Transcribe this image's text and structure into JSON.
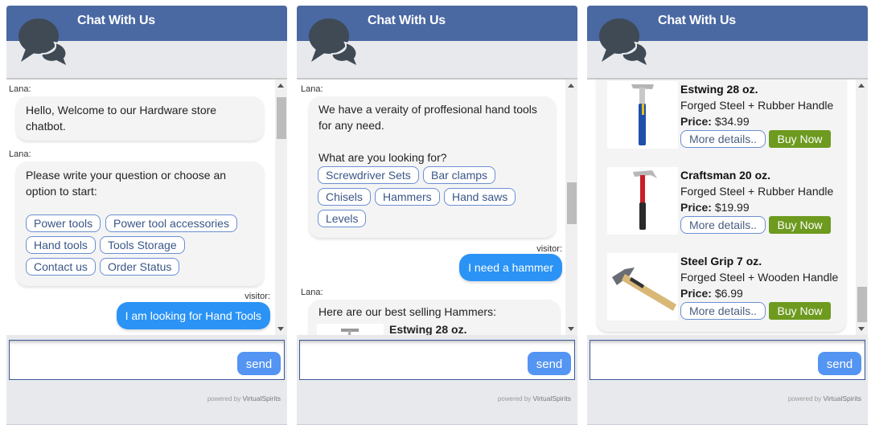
{
  "widgets": [
    {
      "header": {
        "title": "Chat With Us"
      },
      "messages": [
        {
          "sender": "Lana:",
          "text": [
            "Hello, Welcome to our Hardware store",
            "chatbot."
          ]
        },
        {
          "sender": "Lana:",
          "text": [
            "Please write your question or choose an",
            "option to start:"
          ],
          "options": [
            "Power tools",
            "Power tool accessories",
            "Hand tools",
            "Tools Storage",
            "Contact us",
            "Order Status"
          ]
        },
        {
          "sender": "visitor:",
          "text": "I am looking for Hand Tools"
        }
      ],
      "input": {
        "placeholder": "",
        "send_label": "send"
      },
      "powered": {
        "prefix": "powered  by ",
        "brand": "VirtualSpirits"
      }
    },
    {
      "header": {
        "title": "Chat With Us"
      },
      "messages": [
        {
          "sender": "Lana:",
          "text": [
            "We have a veraity of proffesional hand tools",
            "for any need.",
            "",
            "What are you looking for?"
          ],
          "options": [
            "Screwdriver Sets",
            "Bar clamps",
            "Chisels",
            "Hammers",
            "Hand saws",
            "Levels"
          ]
        },
        {
          "sender": "visitor:",
          "text": "I need a hammer"
        },
        {
          "sender": "Lana:",
          "text": "Here are our best selling Hammers:",
          "first_product": "Estwing 28 oz."
        }
      ],
      "input": {
        "placeholder": "",
        "send_label": "send"
      },
      "powered": {
        "prefix": "powered  by ",
        "brand": "VirtualSpirits"
      }
    },
    {
      "header": {
        "title": "Chat With Us"
      },
      "products": [
        {
          "name": "Estwing 28 oz.",
          "desc": "Forged Steel + Rubber Handle",
          "price_label": "Price:",
          "price": "$34.99",
          "more": "More details..",
          "buy": "Buy Now",
          "handle_color": "#1f4fa8"
        },
        {
          "name": "Craftsman 20 oz.",
          "desc": "Forged Steel + Rubber Handle",
          "price_label": "Price:",
          "price": "$19.99",
          "more": "More details..",
          "buy": "Buy Now",
          "handle_color": "#c81e28"
        },
        {
          "name": "Steel Grip 7 oz.",
          "desc": "Forged Steel + Wooden Handle",
          "price_label": "Price:",
          "price": "$6.99",
          "more": "More details..",
          "buy": "Buy Now",
          "handle_color": "#d9b877"
        }
      ],
      "input": {
        "placeholder": "",
        "send_label": "send"
      },
      "powered": {
        "prefix": "powered  by ",
        "brand": "VirtualSpirits"
      }
    }
  ],
  "colors": {
    "header": "#4a68a2",
    "visitor_bubble": "#2a93f5",
    "send": "#5494f2",
    "buy": "#6d9a1f",
    "option_border": "#6b8fd3"
  }
}
